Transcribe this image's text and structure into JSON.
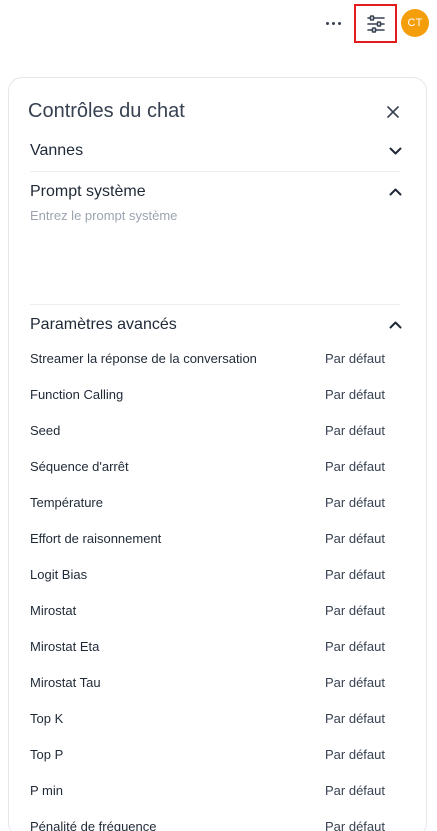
{
  "header": {
    "more_icon": "ellipsis-horizontal-icon",
    "controls_icon": "sliders-icon",
    "avatar_initials": "CT",
    "avatar_color": "#f59e0b",
    "highlight_color": "#e11d1d"
  },
  "panel": {
    "title": "Contrôles du chat",
    "close_icon": "close-icon",
    "sections": {
      "vannes": {
        "label": "Vannes",
        "expanded": false
      },
      "system_prompt": {
        "label": "Prompt système",
        "expanded": true,
        "placeholder": "Entrez le prompt système",
        "value": ""
      },
      "advanced": {
        "label": "Paramètres avancés",
        "expanded": true
      }
    },
    "params": [
      {
        "name": "Streamer la réponse de la conversation",
        "value": "Par défaut"
      },
      {
        "name": "Function Calling",
        "value": "Par défaut"
      },
      {
        "name": "Seed",
        "value": "Par défaut"
      },
      {
        "name": "Séquence d'arrêt",
        "value": "Par défaut"
      },
      {
        "name": "Température",
        "value": "Par défaut"
      },
      {
        "name": "Effort de raisonnement",
        "value": "Par défaut"
      },
      {
        "name": "Logit Bias",
        "value": "Par défaut"
      },
      {
        "name": "Mirostat",
        "value": "Par défaut"
      },
      {
        "name": "Mirostat Eta",
        "value": "Par défaut"
      },
      {
        "name": "Mirostat Tau",
        "value": "Par défaut"
      },
      {
        "name": "Top K",
        "value": "Par défaut"
      },
      {
        "name": "Top P",
        "value": "Par défaut"
      },
      {
        "name": "P min",
        "value": "Par défaut"
      },
      {
        "name": "Pénalité de fréquence",
        "value": "Par défaut"
      }
    ]
  }
}
